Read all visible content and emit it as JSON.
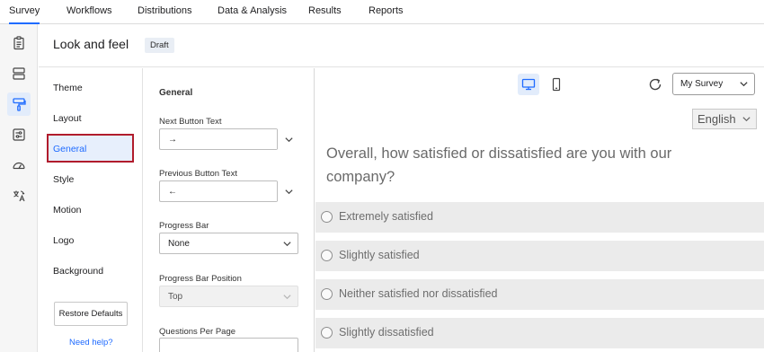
{
  "topnav": {
    "tabs": [
      {
        "label": "Survey"
      },
      {
        "label": "Workflows"
      },
      {
        "label": "Distributions"
      },
      {
        "label": "Data & Analysis"
      },
      {
        "label": "Results"
      },
      {
        "label": "Reports"
      }
    ]
  },
  "rail": {
    "icons": [
      "survey-icon",
      "blocks-icon",
      "paintbrush-icon",
      "options-icon",
      "dashboard-icon",
      "translate-icon"
    ]
  },
  "header": {
    "title": "Look and feel",
    "badge": "Draft"
  },
  "menu": {
    "items": [
      {
        "label": "Theme"
      },
      {
        "label": "Layout"
      },
      {
        "label": "General"
      },
      {
        "label": "Style"
      },
      {
        "label": "Motion"
      },
      {
        "label": "Logo"
      },
      {
        "label": "Background"
      }
    ],
    "restore_label": "Restore Defaults",
    "help_label": "Need help?"
  },
  "settings": {
    "section_title": "General",
    "next_button": {
      "label": "Next Button Text",
      "value": "→"
    },
    "prev_button": {
      "label": "Previous Button Text",
      "value": "←"
    },
    "progress_bar": {
      "label": "Progress Bar",
      "value": "None"
    },
    "progress_position": {
      "label": "Progress Bar Position",
      "value": "Top"
    },
    "questions_per_page": {
      "label": "Questions Per Page"
    }
  },
  "preview": {
    "survey_select": "My Survey",
    "language": "English",
    "question": "Overall, how satisfied or dissatisfied are you with our company?",
    "options": [
      {
        "label": "Extremely satisfied"
      },
      {
        "label": "Slightly satisfied"
      },
      {
        "label": "Neither satisfied nor dissatisfied"
      },
      {
        "label": "Slightly dissatisfied"
      }
    ]
  },
  "colors": {
    "accent": "#1f6bff",
    "highlight_border": "#b11c2c"
  }
}
